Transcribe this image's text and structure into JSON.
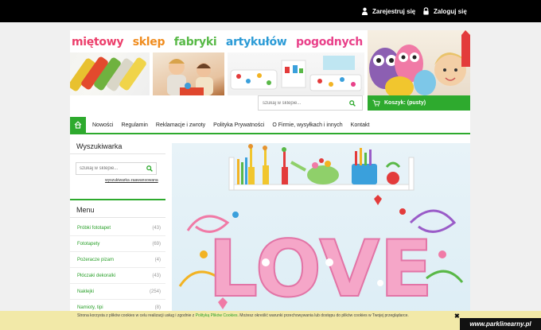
{
  "topbar": {
    "register_label": "Zarejestruj się",
    "login_label": "Zaloguj się"
  },
  "banner": {
    "title_words": [
      {
        "text": "miętowy",
        "color": "#ec3f6b"
      },
      {
        "text": "sklep",
        "color": "#f08c1e"
      },
      {
        "text": "fabryki",
        "color": "#58b947"
      },
      {
        "text": "artykułów",
        "color": "#2c9bd6"
      },
      {
        "text": "pogodnych",
        "color": "#e9418a"
      }
    ]
  },
  "header_search": {
    "placeholder": "szukaj w sklepie..."
  },
  "cart": {
    "label": "Koszyk: (pusty)"
  },
  "nav": {
    "items": [
      "Nowości",
      "Regulamin",
      "Reklamacje i zwroty",
      "Polityka Prywatności",
      "O Firmie, wysyłkach i innych",
      "Kontakt"
    ]
  },
  "sidebar": {
    "search_title": "Wyszukiwarka",
    "search_placeholder": "szukaj w sklepie...",
    "advanced_link": "wyszukiwarka zaawansowana",
    "menu_title": "Menu",
    "menu_items": [
      {
        "label": "Próbki fototapet",
        "count": "(43)"
      },
      {
        "label": "Fototapety",
        "count": "(69)"
      },
      {
        "label": "Pożeracze pizam",
        "count": "(4)"
      },
      {
        "label": "Płóczaki dekoralki",
        "count": "(43)"
      },
      {
        "label": "Naklejki",
        "count": "(254)"
      },
      {
        "label": "Namioty, tipi",
        "count": "(8)"
      }
    ]
  },
  "hero": {
    "word": "LOVE"
  },
  "cookie": {
    "text_before": "Strona korzysta z plików cookies w celu realizacji usług i zgodnie z",
    "policy_link": "Polityką Plików Cookies",
    "text_after": ". Możesz określić warunki przechowywania lub dostępu do plików cookies w Twojej przeglądarce.",
    "close": "✖"
  },
  "watermark": "www.parklinearny.pl",
  "colors": {
    "accent": "#2eaa2e",
    "cookie_bg": "#f2e9a8"
  }
}
